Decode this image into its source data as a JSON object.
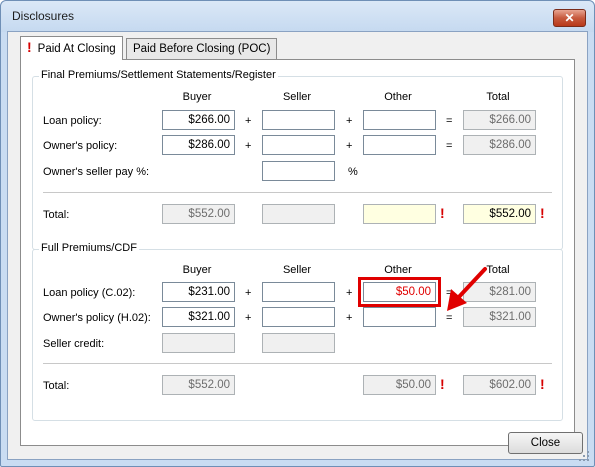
{
  "window": {
    "title": "Disclosures",
    "close_glyph": "✕"
  },
  "tabs": [
    {
      "label": "Paid At Closing",
      "warning": "!"
    },
    {
      "label": "Paid Before Closing (POC)"
    }
  ],
  "final": {
    "title": "Final Premiums/Settlement Statements/Register",
    "columns": {
      "buyer": "Buyer",
      "seller": "Seller",
      "other": "Other",
      "total": "Total"
    },
    "rows": {
      "loan": {
        "label": "Loan policy:",
        "buyer": "$266.00",
        "seller": "",
        "other": "",
        "total": "$266.00"
      },
      "owner": {
        "label": "Owner's policy:",
        "buyer": "$286.00",
        "seller": "",
        "other": "",
        "total": "$286.00"
      },
      "seller_pay": {
        "label": "Owner's seller pay %:",
        "value": "",
        "suffix": "%"
      },
      "total": {
        "label": "Total:",
        "buyer": "$552.00",
        "seller": "",
        "other": "",
        "total": "$552.00"
      }
    },
    "ops": {
      "plus": "+",
      "equals": "="
    }
  },
  "full": {
    "title": "Full Premiums/CDF",
    "columns": {
      "buyer": "Buyer",
      "seller": "Seller",
      "other": "Other",
      "total": "Total"
    },
    "rows": {
      "loan": {
        "label": "Loan policy (C.02):",
        "buyer": "$231.00",
        "seller": "",
        "other": "$50.00",
        "total": "$281.00"
      },
      "owner": {
        "label": "Owner's policy (H.02):",
        "buyer": "$321.00",
        "seller": "",
        "other": "",
        "total": "$321.00"
      },
      "seller_credit": {
        "label": "Seller credit:",
        "buyer": "",
        "seller": ""
      },
      "total": {
        "label": "Total:",
        "buyer": "$552.00",
        "other": "$50.00",
        "total": "$602.00"
      }
    },
    "ops": {
      "plus": "+",
      "equals": "="
    }
  },
  "warning_glyph": "!",
  "buttons": {
    "close": "Close"
  },
  "colors": {
    "warning": "#d60000",
    "highlight": "#e00000",
    "annotation_arrow": "#e00000"
  }
}
